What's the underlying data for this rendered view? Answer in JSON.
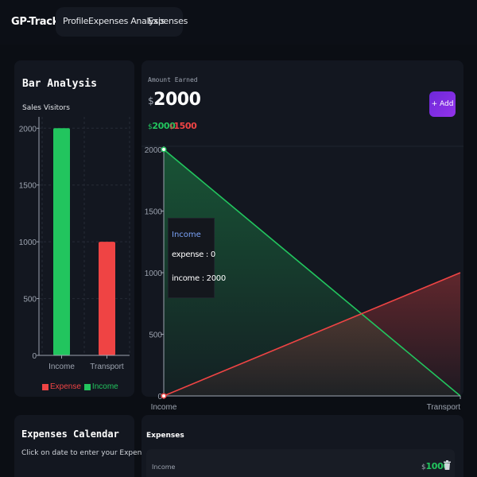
{
  "header": {
    "brand": "GP-Tracker",
    "nav": [
      "Profile",
      "Expenses Analysis",
      "Expenses"
    ]
  },
  "bar_card": {
    "title": "Bar Analysis",
    "subtitle": "Sales Visitors",
    "legend": [
      {
        "label": "Expense",
        "color": "#ef4444"
      },
      {
        "label": "Income",
        "color": "#22c55e"
      }
    ]
  },
  "amount_card": {
    "label": "Amount Earned",
    "currency": "$",
    "amount": "2000",
    "income": "2000",
    "expense": "1500",
    "add_button": "+ Add"
  },
  "tooltip": {
    "title": "Income",
    "expense_line": "expense : 0",
    "income_line": "income : 2000"
  },
  "chart_data": [
    {
      "type": "bar",
      "categories": [
        "Income",
        "Transport"
      ],
      "series": [
        {
          "name": "Income",
          "values": [
            2000,
            null
          ],
          "color": "#22c55e"
        },
        {
          "name": "Expense",
          "values": [
            null,
            1000
          ],
          "color": "#ef4444"
        }
      ],
      "yticks": [
        0,
        500,
        1000,
        1500,
        2000
      ],
      "ylim": [
        0,
        2100
      ],
      "grid": true,
      "legend_position": "bottom"
    },
    {
      "type": "area",
      "categories": [
        "Income",
        "Transport"
      ],
      "series": [
        {
          "name": "income",
          "values": [
            2000,
            0
          ],
          "color": "#22c55e"
        },
        {
          "name": "expense",
          "values": [
            0,
            1000
          ],
          "color": "#ef4444"
        }
      ],
      "yticks": [
        0,
        500,
        1000,
        1500,
        2000
      ],
      "ylim": [
        0,
        2000
      ],
      "grid": false
    }
  ],
  "calendar": {
    "title": "Expenses Calendar",
    "subtitle": "Click on date to enter your Expense"
  },
  "expenses": {
    "title": "Expenses",
    "rows": [
      {
        "category": "Income",
        "currency": "$",
        "amount": "1000"
      }
    ]
  }
}
